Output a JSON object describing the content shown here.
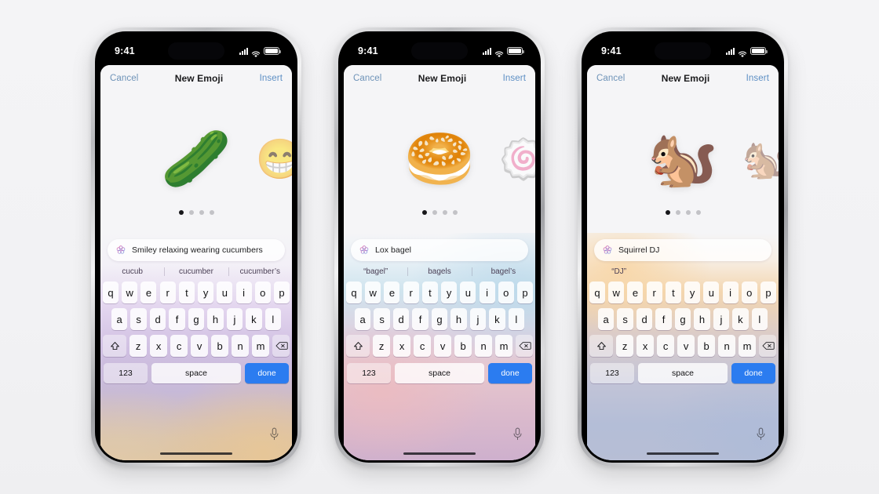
{
  "background_color": "#f3f3f5",
  "accent_colors": {
    "link_blue": "#5d8fc4",
    "done_blue": "#2b7cf0",
    "active_dot": "#17171a",
    "inactive_dot": "#c3c3c7"
  },
  "keyboard_layout": {
    "row1": [
      "q",
      "w",
      "e",
      "r",
      "t",
      "y",
      "u",
      "i",
      "o",
      "p"
    ],
    "row2": [
      "a",
      "s",
      "d",
      "f",
      "g",
      "h",
      "j",
      "k",
      "l"
    ],
    "row3": [
      "z",
      "x",
      "c",
      "v",
      "b",
      "n",
      "m"
    ],
    "shift_icon": "shift-icon",
    "delete_icon": "delete-backspace-icon",
    "numbers_label": "123",
    "space_label": "space",
    "done_label": "done",
    "mic_icon": "microphone-icon"
  },
  "status_bar": {
    "time": "9:41",
    "signal_icon": "cellular-signal-icon",
    "wifi_icon": "wifi-icon",
    "battery_icon": "battery-icon"
  },
  "nav_bar": {
    "cancel_label": "Cancel",
    "title": "New Emoji",
    "insert_label": "Insert"
  },
  "phones": [
    {
      "id": "phone-cucumber",
      "gradient_class": "g-purple",
      "emoji_main": "🥒",
      "emoji_main_name": "smiley-cucumber-eyes-emoji",
      "emoji_side": "😁",
      "emoji_side_name": "grinning-face-cucumber-eyes-emoji",
      "page_dots": 4,
      "active_dot_index": 0,
      "input_value": "Smiley relaxing wearing cucumbers",
      "input_icon": "genmoji-sparkle-icon",
      "suggestions": [
        "cucub",
        "cucumber",
        "cucumber’s"
      ]
    },
    {
      "id": "phone-bagel",
      "gradient_class": "g-pink",
      "emoji_main": "🥯",
      "emoji_main_name": "lox-bagel-emoji",
      "emoji_side": "🍥",
      "emoji_side_name": "open-bagel-with-lox-emoji",
      "page_dots": 4,
      "active_dot_index": 0,
      "input_value": "Lox bagel",
      "input_icon": "genmoji-sparkle-icon",
      "suggestions": [
        "“bagel”",
        "bagels",
        "bagel’s"
      ]
    },
    {
      "id": "phone-squirrel",
      "gradient_class": "g-warm",
      "emoji_main": "🐿️",
      "emoji_main_name": "squirrel-dj-emoji",
      "emoji_side": "🐿️",
      "emoji_side_name": "squirrel-dj-alternate-emoji",
      "page_dots": 4,
      "active_dot_index": 0,
      "input_value": "Squirrel DJ",
      "input_icon": "genmoji-sparkle-icon",
      "suggestions": [
        "“DJ”",
        "",
        ""
      ]
    }
  ]
}
